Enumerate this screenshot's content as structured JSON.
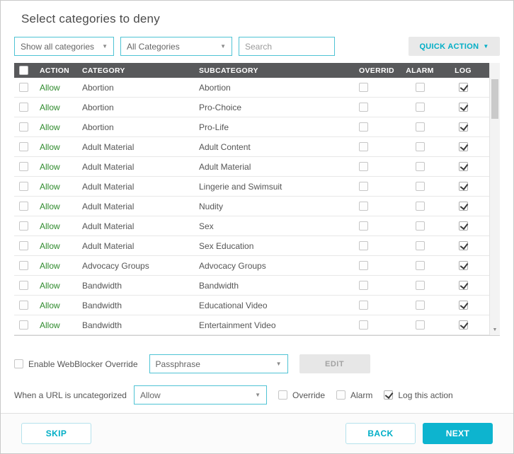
{
  "colors": {
    "accent": "#00aec6",
    "accent_border": "#4fc3d4",
    "primary": "#0db4cf",
    "allow": "#2f8a2d",
    "head": "#58595b"
  },
  "dialog": {
    "title": "Select categories to deny"
  },
  "filters": {
    "show_filter_value": "Show all categories",
    "category_filter_value": "All Categories",
    "search_placeholder": "Search",
    "quick_action_label": "QUICK ACTION"
  },
  "table": {
    "select_all": false,
    "headers": {
      "action": "ACTION",
      "category": "CATEGORY",
      "subcategory": "SUBCATEGORY",
      "override": "OVERRID",
      "alarm": "ALARM",
      "log": "LOG"
    },
    "rows": [
      {
        "action": "Allow",
        "category": "Abortion",
        "subcategory": "Abortion",
        "selected": false,
        "override": false,
        "alarm": false,
        "log": true
      },
      {
        "action": "Allow",
        "category": "Abortion",
        "subcategory": "Pro-Choice",
        "selected": false,
        "override": false,
        "alarm": false,
        "log": true
      },
      {
        "action": "Allow",
        "category": "Abortion",
        "subcategory": "Pro-Life",
        "selected": false,
        "override": false,
        "alarm": false,
        "log": true
      },
      {
        "action": "Allow",
        "category": "Adult Material",
        "subcategory": "Adult Content",
        "selected": false,
        "override": false,
        "alarm": false,
        "log": true
      },
      {
        "action": "Allow",
        "category": "Adult Material",
        "subcategory": "Adult Material",
        "selected": false,
        "override": false,
        "alarm": false,
        "log": true
      },
      {
        "action": "Allow",
        "category": "Adult Material",
        "subcategory": "Lingerie and Swimsuit",
        "selected": false,
        "override": false,
        "alarm": false,
        "log": true
      },
      {
        "action": "Allow",
        "category": "Adult Material",
        "subcategory": "Nudity",
        "selected": false,
        "override": false,
        "alarm": false,
        "log": true
      },
      {
        "action": "Allow",
        "category": "Adult Material",
        "subcategory": "Sex",
        "selected": false,
        "override": false,
        "alarm": false,
        "log": true
      },
      {
        "action": "Allow",
        "category": "Adult Material",
        "subcategory": "Sex Education",
        "selected": false,
        "override": false,
        "alarm": false,
        "log": true
      },
      {
        "action": "Allow",
        "category": "Advocacy Groups",
        "subcategory": "Advocacy Groups",
        "selected": false,
        "override": false,
        "alarm": false,
        "log": true
      },
      {
        "action": "Allow",
        "category": "Bandwidth",
        "subcategory": "Bandwidth",
        "selected": false,
        "override": false,
        "alarm": false,
        "log": true
      },
      {
        "action": "Allow",
        "category": "Bandwidth",
        "subcategory": "Educational Video",
        "selected": false,
        "override": false,
        "alarm": false,
        "log": true
      },
      {
        "action": "Allow",
        "category": "Bandwidth",
        "subcategory": "Entertainment Video",
        "selected": false,
        "override": false,
        "alarm": false,
        "log": true
      }
    ]
  },
  "override_row": {
    "enabled": false,
    "checkbox_label": "Enable WebBlocker Override",
    "dropdown_value": "Passphrase",
    "edit_label": "EDIT"
  },
  "uncategorized_row": {
    "label": "When a URL is uncategorized",
    "dropdown_value": "Allow",
    "override_label": "Override",
    "override_checked": false,
    "alarm_label": "Alarm",
    "alarm_checked": false,
    "log_label": "Log this action",
    "log_checked": true
  },
  "footer": {
    "skip_label": "SKIP",
    "back_label": "BACK",
    "next_label": "NEXT"
  }
}
